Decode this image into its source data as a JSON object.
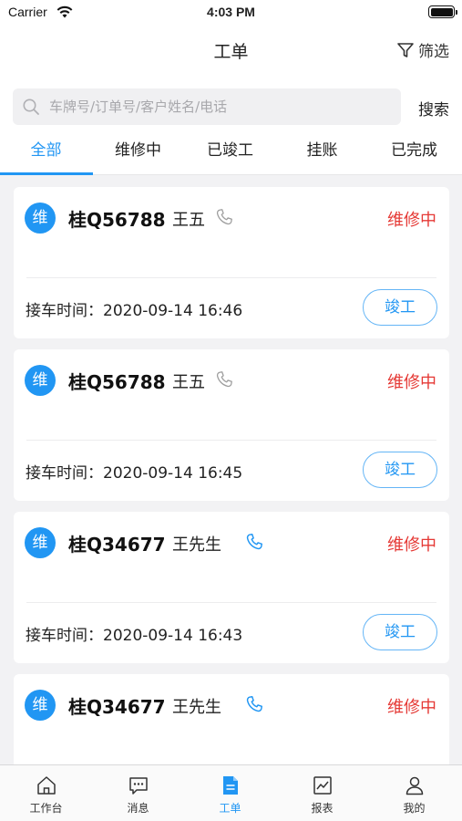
{
  "status_bar": {
    "carrier": "Carrier",
    "time": "4:03 PM"
  },
  "header": {
    "title": "工单",
    "filter_label": "筛选"
  },
  "search": {
    "placeholder": "车牌号/订单号/客户姓名/电话",
    "value": "",
    "button_label": "搜索"
  },
  "tabs": [
    {
      "label": "全部",
      "active": true
    },
    {
      "label": "维修中",
      "active": false
    },
    {
      "label": "已竣工",
      "active": false
    },
    {
      "label": "挂账",
      "active": false
    },
    {
      "label": "已完成",
      "active": false
    }
  ],
  "orders": [
    {
      "badge": "维",
      "plate": "桂Q56788",
      "customer": "王五",
      "phone_icon": "phone-icon-gray",
      "status": "维修中",
      "time_text": "接车时间：2020-09-14 16:46",
      "action_label": "竣工"
    },
    {
      "badge": "维",
      "plate": "桂Q56788",
      "customer": "王五",
      "phone_icon": "phone-icon-gray",
      "status": "维修中",
      "time_text": "接车时间：2020-09-14 16:45",
      "action_label": "竣工"
    },
    {
      "badge": "维",
      "plate": "桂Q34677",
      "customer": "王先生",
      "phone_icon": "phone-icon-blue",
      "status": "维修中",
      "time_text": "接车时间：2020-09-14 16:43",
      "action_label": "竣工"
    },
    {
      "badge": "维",
      "plate": "桂Q34677",
      "customer": "王先生",
      "phone_icon": "phone-icon-blue",
      "status": "维修中"
    }
  ],
  "tab_bar": [
    {
      "label": "工作台",
      "icon": "home-icon",
      "active": false
    },
    {
      "label": "消息",
      "icon": "message-icon",
      "active": false
    },
    {
      "label": "工单",
      "icon": "document-icon",
      "active": true
    },
    {
      "label": "报表",
      "icon": "chart-icon",
      "active": false
    },
    {
      "label": "我的",
      "icon": "user-icon",
      "active": false
    }
  ],
  "colors": {
    "accent": "#2196f3",
    "status_red": "#e53935",
    "phone_gray": "#9e9e9e"
  }
}
